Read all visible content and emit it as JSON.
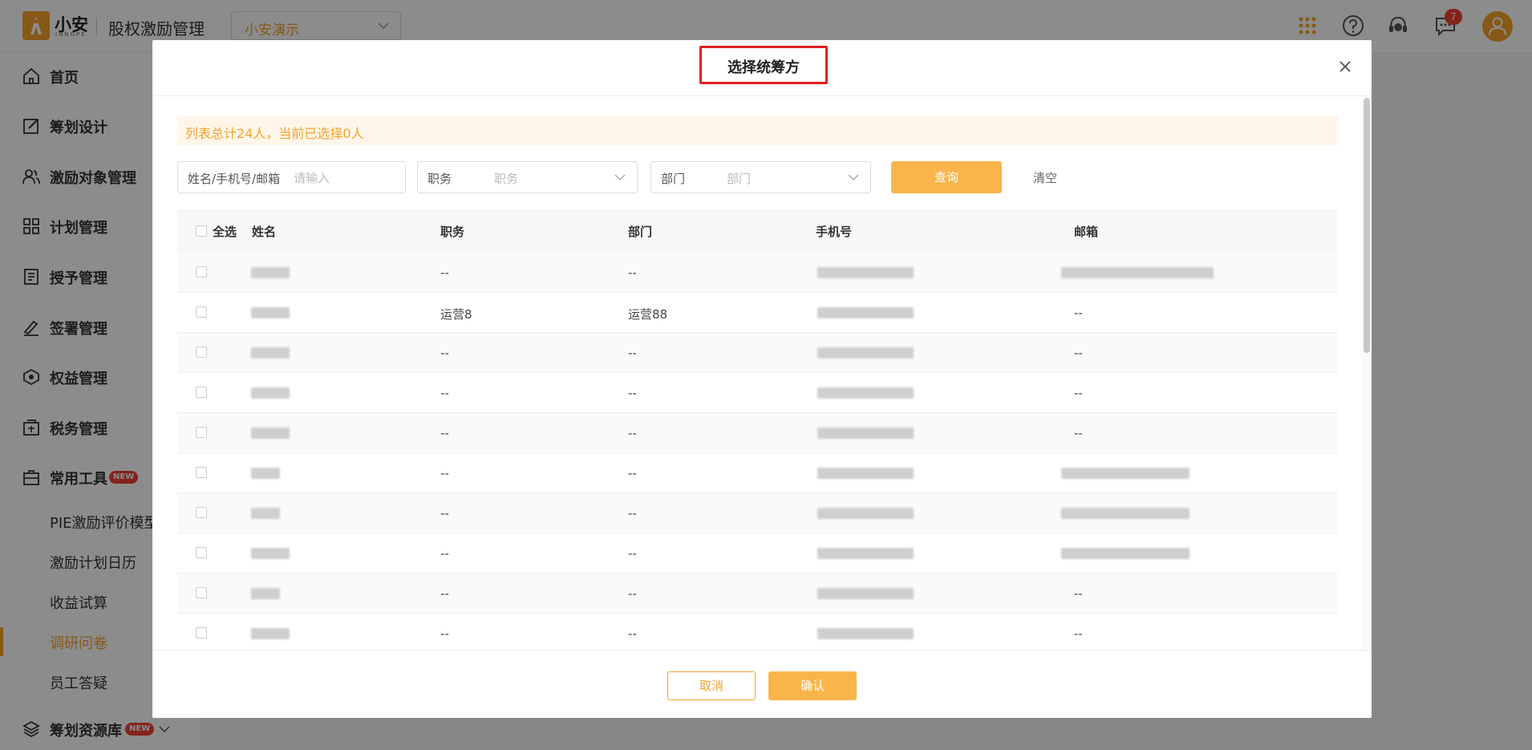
{
  "header": {
    "logo_text": "小安",
    "logo_sub": "INNOPE",
    "app_title": "股权激励管理",
    "company": "小安演示",
    "notifications_count": "7",
    "icons": [
      "apps-grid-icon",
      "help-icon",
      "customer-service-icon",
      "message-icon",
      "user-avatar-icon"
    ]
  },
  "sidebar": {
    "items": [
      {
        "label": "首页",
        "icon": "home-icon"
      },
      {
        "label": "筹划设计",
        "icon": "edit-icon"
      },
      {
        "label": "激励对象管理",
        "icon": "users-icon"
      },
      {
        "label": "计划管理",
        "icon": "grid-icon"
      },
      {
        "label": "授予管理",
        "icon": "document-icon"
      },
      {
        "label": "签署管理",
        "icon": "sign-icon"
      },
      {
        "label": "权益管理",
        "icon": "equity-icon"
      },
      {
        "label": "税务管理",
        "icon": "tax-icon"
      },
      {
        "label": "常用工具",
        "icon": "toolbox-icon",
        "tag": "NEW"
      }
    ],
    "sub_items": [
      {
        "label": "PIE激励评价模型",
        "active": false
      },
      {
        "label": "激励计划日历",
        "active": false
      },
      {
        "label": "收益试算",
        "active": false
      },
      {
        "label": "调研问卷",
        "active": true
      },
      {
        "label": "员工答疑",
        "active": false
      }
    ],
    "resource": {
      "label": "筹划资源库",
      "icon": "layers-icon",
      "tag": "NEW"
    }
  },
  "modal": {
    "title": "选择统筹方",
    "notice": "列表总计24人，当前已选择0人",
    "filters": {
      "name_label": "姓名/手机号/邮箱",
      "name_placeholder": "请输入",
      "position_label": "职务",
      "position_placeholder": "职务",
      "dept_label": "部门",
      "dept_placeholder": "部门"
    },
    "query_label": "查询",
    "clear_label": "清空",
    "table": {
      "select_all": "全选",
      "columns": [
        "姓名",
        "职务",
        "部门",
        "手机号",
        "邮箱"
      ],
      "rows": [
        {
          "position": "--",
          "dept": "--",
          "email_hidden": true,
          "email": ""
        },
        {
          "position": "运营8",
          "dept": "运营88",
          "email_hidden": false,
          "email": "--"
        },
        {
          "position": "--",
          "dept": "--",
          "email_hidden": false,
          "email": "--"
        },
        {
          "position": "--",
          "dept": "--",
          "email_hidden": false,
          "email": "--"
        },
        {
          "position": "--",
          "dept": "--",
          "email_hidden": false,
          "email": "--"
        },
        {
          "position": "--",
          "dept": "--",
          "email_hidden": true,
          "email": ""
        },
        {
          "position": "--",
          "dept": "--",
          "email_hidden": true,
          "email": ""
        },
        {
          "position": "--",
          "dept": "--",
          "email_hidden": true,
          "email": ""
        },
        {
          "position": "--",
          "dept": "--",
          "email_hidden": false,
          "email": "--"
        },
        {
          "position": "--",
          "dept": "--",
          "email_hidden": false,
          "email": "--"
        }
      ]
    },
    "cancel_label": "取消",
    "confirm_label": "确认"
  },
  "colors": {
    "accent": "#f4a32a",
    "highlight_border": "#e02020",
    "badge": "#f04134"
  }
}
